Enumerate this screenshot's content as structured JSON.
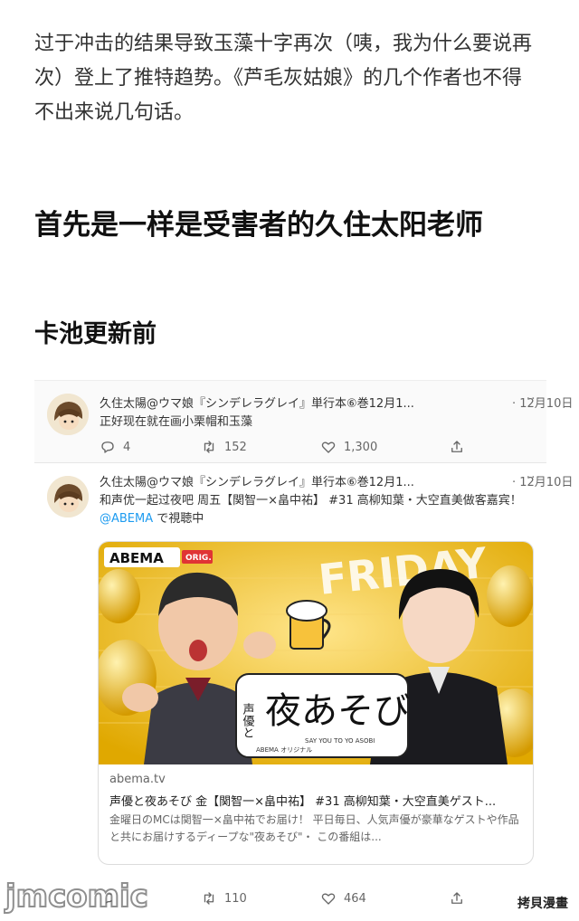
{
  "article": {
    "intro": "过于冲击的结果导致玉藻十字再次（咦，我为什么要说再次）登上了推特趋势。《芦毛灰姑娘》的几个作者也不得不出来说几句话。",
    "heading1": "首先是一样是受害者的久住太阳老师",
    "heading2": "卡池更新前"
  },
  "tweets": [
    {
      "username": "久住太陽@ウマ娘『シンデレラグレイ』単行本⑥巻12月1...",
      "date": "· 12月10日",
      "more": "···",
      "text": "正好现在就在画小栗帽和玉藻",
      "replies": "4",
      "retweets": "152",
      "likes": "1,300"
    },
    {
      "username": "久住太陽@ウマ娘『シンデレラグレイ』単行本⑥巻12月1...",
      "date": "· 12月10日",
      "more": "···",
      "text_main": "和声优一起过夜吧 周五【関智一×畠中祐】 #31 高柳知葉・大空直美做客嘉宾！ ",
      "mention": "@ABEMA",
      "text_tail": " で視聴中",
      "card": {
        "logo": "ABEMA",
        "logo_tag": "ORIG.",
        "banner": "FRIDAY",
        "show_title_vertical": "声優と",
        "show_title": "夜あそび",
        "show_subtitle": "SAY YOU TO YO ASOBI",
        "show_badge": "ABEMA オリジナル",
        "domain": "abema.tv",
        "title": "声優と夜あそび 金【関智一×畠中祐】 #31 高柳知葉・大空直美ゲスト...",
        "description": "金曜日のMCは関智一×畠中祐でお届け！ 平日毎日、人気声優が豪華なゲストや作品と共にお届けするディープな\"夜あそび\"・ この番組は..."
      },
      "retweets": "110",
      "likes": "464"
    }
  ],
  "watermark": {
    "left": "jmcomic",
    "right": "拷貝漫畫"
  },
  "colors": {
    "link": "#1d9bf0",
    "card_bg": "#f2c230"
  }
}
